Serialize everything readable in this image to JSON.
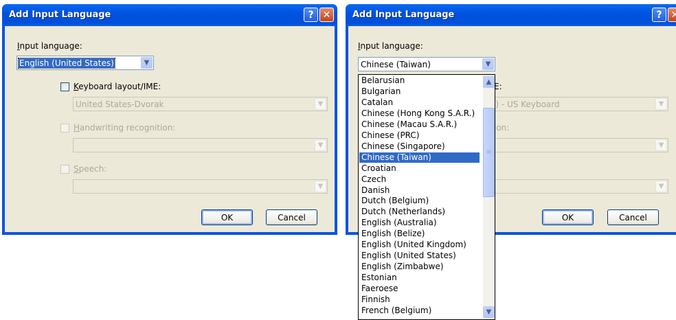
{
  "dialog1": {
    "title": "Add Input Language",
    "help_glyph": "?",
    "close_glyph": "✕",
    "input_language_label_u": "I",
    "input_language_label_rest": "nput language:",
    "input_language_value": "English (United States)",
    "keyboard_label_u": "K",
    "keyboard_label_rest": "eyboard layout/IME:",
    "keyboard_value": "United States-Dvorak",
    "handwriting_label_u": "H",
    "handwriting_label_rest": "andwriting recognition:",
    "speech_label_u": "S",
    "speech_label_rest": "peech:",
    "ok_label": "OK",
    "cancel_label": "Cancel"
  },
  "dialog2": {
    "title": "Add Input Language",
    "help_glyph": "?",
    "close_glyph": "✕",
    "input_language_label_u": "I",
    "input_language_label_rest": "nput language:",
    "input_language_value": "Chinese (Taiwan)",
    "keyboard_label_partial": "E:",
    "keyboard_value_partial": "l) - US Keyboard",
    "handwriting_label_partial": "ion:",
    "ok_label": "OK",
    "cancel_label": "Cancel"
  },
  "dropdown": {
    "items": [
      "Belarusian",
      "Bulgarian",
      "Catalan",
      "Chinese (Hong Kong S.A.R.)",
      "Chinese (Macau S.A.R.)",
      "Chinese (PRC)",
      "Chinese (Singapore)",
      "Chinese (Taiwan)",
      "Croatian",
      "Czech",
      "Danish",
      "Dutch (Belgium)",
      "Dutch (Netherlands)",
      "English (Australia)",
      "English (Belize)",
      "English (United Kingdom)",
      "English (United States)",
      "English (Zimbabwe)",
      "Estonian",
      "Faeroese",
      "Finnish",
      "French (Belgium)"
    ],
    "selected": "Chinese (Taiwan)"
  },
  "icons": {
    "dropdown_arrow": "chevron-down-icon",
    "scroll_up": "chevron-up-icon",
    "scroll_down": "chevron-down-icon",
    "thumb_grip": "grip-icon"
  },
  "colors": {
    "titlebar": "#0054e3",
    "dialog_bg": "#ece9d8",
    "selection": "#316ac5"
  }
}
